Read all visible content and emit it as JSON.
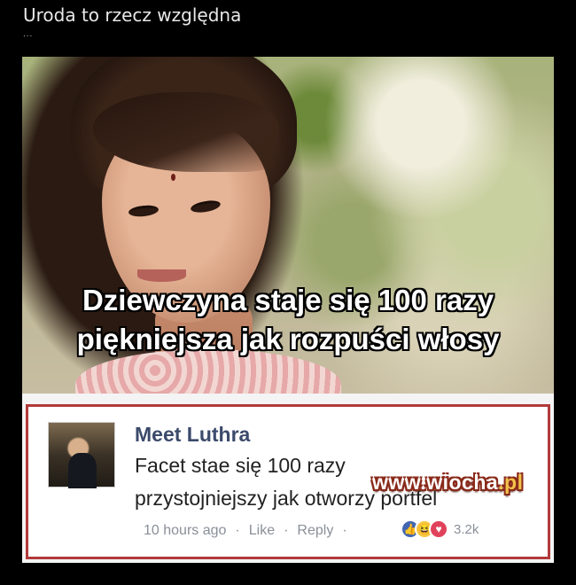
{
  "post": {
    "title": "Uroda to rzecz względna",
    "ellipsis": "..."
  },
  "meme": {
    "caption_line1": "Dziewczyna staje się 100 razy",
    "caption_line2": "piękniejsza jak rozpuści włosy"
  },
  "comment": {
    "author": "Meet Luthra",
    "text_line1": "Facet stae się 100 razy",
    "text_line2": "przystojniejszy jak otworzy portfel",
    "time": "10 hours ago",
    "like_label": "Like",
    "reply_label": "Reply",
    "separator": "·",
    "reaction_count": "3.2k",
    "reactions": [
      "like-icon",
      "haha-icon",
      "love-icon"
    ],
    "border_color": "#b23a3a",
    "author_color": "#3b4a6b"
  },
  "watermark": {
    "site": "www.wiocha",
    "tld": ".pl"
  }
}
